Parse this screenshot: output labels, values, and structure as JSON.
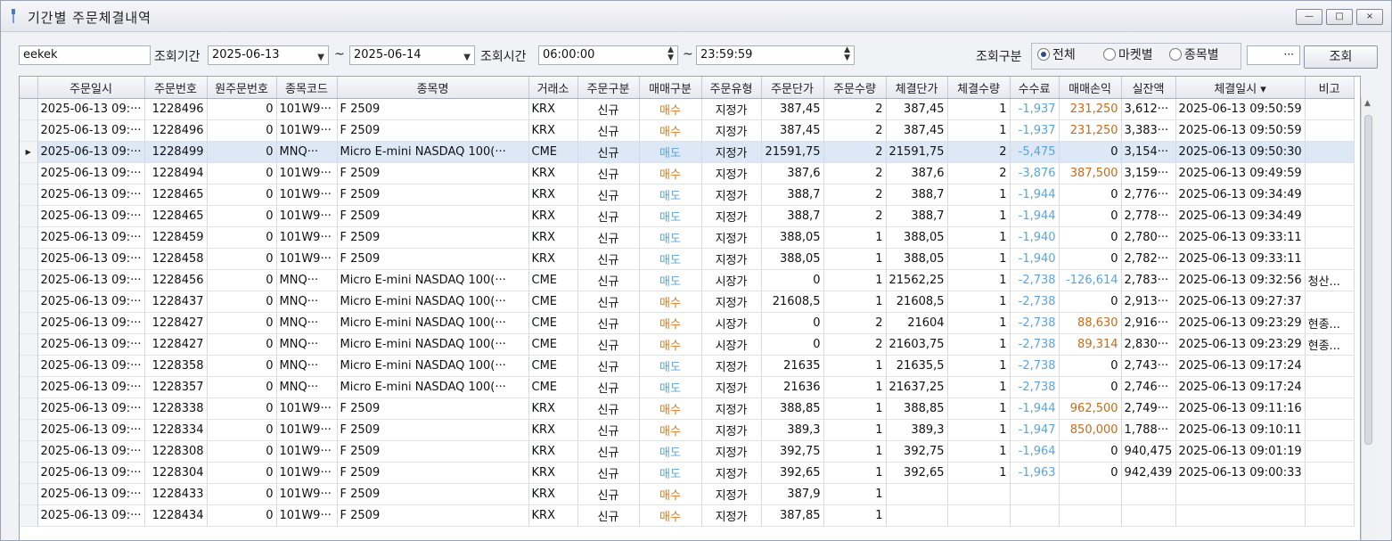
{
  "window": {
    "title": "기간별 주문체결내역",
    "btn_min": "—",
    "btn_max": "□",
    "btn_close": "×"
  },
  "toolbar": {
    "account": "eekek",
    "period_label": "조회기간",
    "date_from": "2025-06-13",
    "tilde": "~",
    "date_to": "2025-06-14",
    "time_label": "조회시간",
    "time_from": "06:00:00",
    "time_to": "23:59:59",
    "category_label": "조회구분",
    "radio_all": "전체",
    "radio_market": "마켓별",
    "radio_item": "종목별",
    "dots": "···",
    "query_button": "조회"
  },
  "table": {
    "columns": [
      "주문일시",
      "주문번호",
      "원주문번호",
      "종목코드",
      "종목명",
      "거래소",
      "주문구분",
      "매매구분",
      "주문유형",
      "주문단가",
      "주문수량",
      "체결단가",
      "체결수량",
      "수수료",
      "매매손익",
      "실잔액",
      "체결일시 ▾",
      "비고"
    ],
    "rows": [
      {
        "dt": "2025-06-13 09:···",
        "no": "1228496",
        "orig": "0",
        "code": "101W9···",
        "name": "F 2509",
        "ex": "KRX",
        "kind": "신규",
        "side": "매수",
        "type": "지정가",
        "price": "387,45",
        "qty": "2",
        "fprice": "387,45",
        "fqty": "1",
        "fee": "-1,937",
        "pnl": "231,250",
        "bal": "3,612···",
        "fdt": "2025-06-13 09:50:59",
        "note": ""
      },
      {
        "dt": "2025-06-13 09:···",
        "no": "1228496",
        "orig": "0",
        "code": "101W9···",
        "name": "F 2509",
        "ex": "KRX",
        "kind": "신규",
        "side": "매수",
        "type": "지정가",
        "price": "387,45",
        "qty": "2",
        "fprice": "387,45",
        "fqty": "1",
        "fee": "-1,937",
        "pnl": "231,250",
        "bal": "3,383···",
        "fdt": "2025-06-13 09:50:59",
        "note": ""
      },
      {
        "dt": "2025-06-13 09:···",
        "no": "1228499",
        "orig": "0",
        "code": "MNQ···",
        "name": "Micro E-mini NASDAQ 100(···",
        "ex": "CME",
        "kind": "신규",
        "side": "매도",
        "type": "지정가",
        "price": "21591,75",
        "qty": "2",
        "fprice": "21591,75",
        "fqty": "2",
        "fee": "-5,475",
        "pnl": "0",
        "bal": "3,154···",
        "fdt": "2025-06-13 09:50:30",
        "note": "",
        "selected": true
      },
      {
        "dt": "2025-06-13 09:···",
        "no": "1228494",
        "orig": "0",
        "code": "101W9···",
        "name": "F 2509",
        "ex": "KRX",
        "kind": "신규",
        "side": "매수",
        "type": "지정가",
        "price": "387,6",
        "qty": "2",
        "fprice": "387,6",
        "fqty": "2",
        "fee": "-3,876",
        "pnl": "387,500",
        "bal": "3,159···",
        "fdt": "2025-06-13 09:49:59",
        "note": ""
      },
      {
        "dt": "2025-06-13 09:···",
        "no": "1228465",
        "orig": "0",
        "code": "101W9···",
        "name": "F 2509",
        "ex": "KRX",
        "kind": "신규",
        "side": "매도",
        "type": "지정가",
        "price": "388,7",
        "qty": "2",
        "fprice": "388,7",
        "fqty": "1",
        "fee": "-1,944",
        "pnl": "0",
        "bal": "2,776···",
        "fdt": "2025-06-13 09:34:49",
        "note": ""
      },
      {
        "dt": "2025-06-13 09:···",
        "no": "1228465",
        "orig": "0",
        "code": "101W9···",
        "name": "F 2509",
        "ex": "KRX",
        "kind": "신규",
        "side": "매도",
        "type": "지정가",
        "price": "388,7",
        "qty": "2",
        "fprice": "388,7",
        "fqty": "1",
        "fee": "-1,944",
        "pnl": "0",
        "bal": "2,778···",
        "fdt": "2025-06-13 09:34:49",
        "note": ""
      },
      {
        "dt": "2025-06-13 09:···",
        "no": "1228459",
        "orig": "0",
        "code": "101W9···",
        "name": "F 2509",
        "ex": "KRX",
        "kind": "신규",
        "side": "매도",
        "type": "지정가",
        "price": "388,05",
        "qty": "1",
        "fprice": "388,05",
        "fqty": "1",
        "fee": "-1,940",
        "pnl": "0",
        "bal": "2,780···",
        "fdt": "2025-06-13 09:33:11",
        "note": ""
      },
      {
        "dt": "2025-06-13 09:···",
        "no": "1228458",
        "orig": "0",
        "code": "101W9···",
        "name": "F 2509",
        "ex": "KRX",
        "kind": "신규",
        "side": "매도",
        "type": "지정가",
        "price": "388,05",
        "qty": "1",
        "fprice": "388,05",
        "fqty": "1",
        "fee": "-1,940",
        "pnl": "0",
        "bal": "2,782···",
        "fdt": "2025-06-13 09:33:11",
        "note": ""
      },
      {
        "dt": "2025-06-13 09:···",
        "no": "1228456",
        "orig": "0",
        "code": "MNQ···",
        "name": "Micro E-mini NASDAQ 100(···",
        "ex": "CME",
        "kind": "신규",
        "side": "매도",
        "type": "시장가",
        "price": "0",
        "qty": "1",
        "fprice": "21562,25",
        "fqty": "1",
        "fee": "-2,738",
        "pnl": "-126,614",
        "bal": "2,783···",
        "fdt": "2025-06-13 09:32:56",
        "note": "청산..."
      },
      {
        "dt": "2025-06-13 09:···",
        "no": "1228437",
        "orig": "0",
        "code": "MNQ···",
        "name": "Micro E-mini NASDAQ 100(···",
        "ex": "CME",
        "kind": "신규",
        "side": "매수",
        "type": "지정가",
        "price": "21608,5",
        "qty": "1",
        "fprice": "21608,5",
        "fqty": "1",
        "fee": "-2,738",
        "pnl": "0",
        "bal": "2,913···",
        "fdt": "2025-06-13 09:27:37",
        "note": ""
      },
      {
        "dt": "2025-06-13 09:···",
        "no": "1228427",
        "orig": "0",
        "code": "MNQ···",
        "name": "Micro E-mini NASDAQ 100(···",
        "ex": "CME",
        "kind": "신규",
        "side": "매수",
        "type": "시장가",
        "price": "0",
        "qty": "2",
        "fprice": "21604",
        "fqty": "1",
        "fee": "-2,738",
        "pnl": "88,630",
        "bal": "2,916···",
        "fdt": "2025-06-13 09:23:29",
        "note": "현종..."
      },
      {
        "dt": "2025-06-13 09:···",
        "no": "1228427",
        "orig": "0",
        "code": "MNQ···",
        "name": "Micro E-mini NASDAQ 100(···",
        "ex": "CME",
        "kind": "신규",
        "side": "매수",
        "type": "시장가",
        "price": "0",
        "qty": "2",
        "fprice": "21603,75",
        "fqty": "1",
        "fee": "-2,738",
        "pnl": "89,314",
        "bal": "2,830···",
        "fdt": "2025-06-13 09:23:29",
        "note": "현종..."
      },
      {
        "dt": "2025-06-13 09:···",
        "no": "1228358",
        "orig": "0",
        "code": "MNQ···",
        "name": "Micro E-mini NASDAQ 100(···",
        "ex": "CME",
        "kind": "신규",
        "side": "매도",
        "type": "지정가",
        "price": "21635",
        "qty": "1",
        "fprice": "21635,5",
        "fqty": "1",
        "fee": "-2,738",
        "pnl": "0",
        "bal": "2,743···",
        "fdt": "2025-06-13 09:17:24",
        "note": ""
      },
      {
        "dt": "2025-06-13 09:···",
        "no": "1228357",
        "orig": "0",
        "code": "MNQ···",
        "name": "Micro E-mini NASDAQ 100(···",
        "ex": "CME",
        "kind": "신규",
        "side": "매도",
        "type": "지정가",
        "price": "21636",
        "qty": "1",
        "fprice": "21637,25",
        "fqty": "1",
        "fee": "-2,738",
        "pnl": "0",
        "bal": "2,746···",
        "fdt": "2025-06-13 09:17:24",
        "note": ""
      },
      {
        "dt": "2025-06-13 09:···",
        "no": "1228338",
        "orig": "0",
        "code": "101W9···",
        "name": "F 2509",
        "ex": "KRX",
        "kind": "신규",
        "side": "매수",
        "type": "지정가",
        "price": "388,85",
        "qty": "1",
        "fprice": "388,85",
        "fqty": "1",
        "fee": "-1,944",
        "pnl": "962,500",
        "bal": "2,749···",
        "fdt": "2025-06-13 09:11:16",
        "note": ""
      },
      {
        "dt": "2025-06-13 09:···",
        "no": "1228334",
        "orig": "0",
        "code": "101W9···",
        "name": "F 2509",
        "ex": "KRX",
        "kind": "신규",
        "side": "매수",
        "type": "지정가",
        "price": "389,3",
        "qty": "1",
        "fprice": "389,3",
        "fqty": "1",
        "fee": "-1,947",
        "pnl": "850,000",
        "bal": "1,788···",
        "fdt": "2025-06-13 09:10:11",
        "note": ""
      },
      {
        "dt": "2025-06-13 09:···",
        "no": "1228308",
        "orig": "0",
        "code": "101W9···",
        "name": "F 2509",
        "ex": "KRX",
        "kind": "신규",
        "side": "매도",
        "type": "지정가",
        "price": "392,75",
        "qty": "1",
        "fprice": "392,75",
        "fqty": "1",
        "fee": "-1,964",
        "pnl": "0",
        "bal": "940,475",
        "fdt": "2025-06-13 09:01:19",
        "note": ""
      },
      {
        "dt": "2025-06-13 09:···",
        "no": "1228304",
        "orig": "0",
        "code": "101W9···",
        "name": "F 2509",
        "ex": "KRX",
        "kind": "신규",
        "side": "매도",
        "type": "지정가",
        "price": "392,65",
        "qty": "1",
        "fprice": "392,65",
        "fqty": "1",
        "fee": "-1,963",
        "pnl": "0",
        "bal": "942,439",
        "fdt": "2025-06-13 09:00:33",
        "note": ""
      },
      {
        "dt": "2025-06-13 09:···",
        "no": "1228433",
        "orig": "0",
        "code": "101W9···",
        "name": "F 2509",
        "ex": "KRX",
        "kind": "신규",
        "side": "매수",
        "type": "지정가",
        "price": "387,9",
        "qty": "1",
        "fprice": "",
        "fqty": "",
        "fee": "",
        "pnl": "",
        "bal": "",
        "fdt": "",
        "note": ""
      },
      {
        "dt": "2025-06-13 09:···",
        "no": "1228434",
        "orig": "0",
        "code": "101W9···",
        "name": "F 2509",
        "ex": "KRX",
        "kind": "신규",
        "side": "매수",
        "type": "지정가",
        "price": "387,85",
        "qty": "1",
        "fprice": "",
        "fqty": "",
        "fee": "",
        "pnl": "",
        "bal": "",
        "fdt": "",
        "note": ""
      }
    ]
  },
  "colors": {
    "buy": "#e07a1f",
    "sell": "#5aa5d8",
    "profit": "#c86a1a",
    "selected_row": "#dde8f7"
  }
}
